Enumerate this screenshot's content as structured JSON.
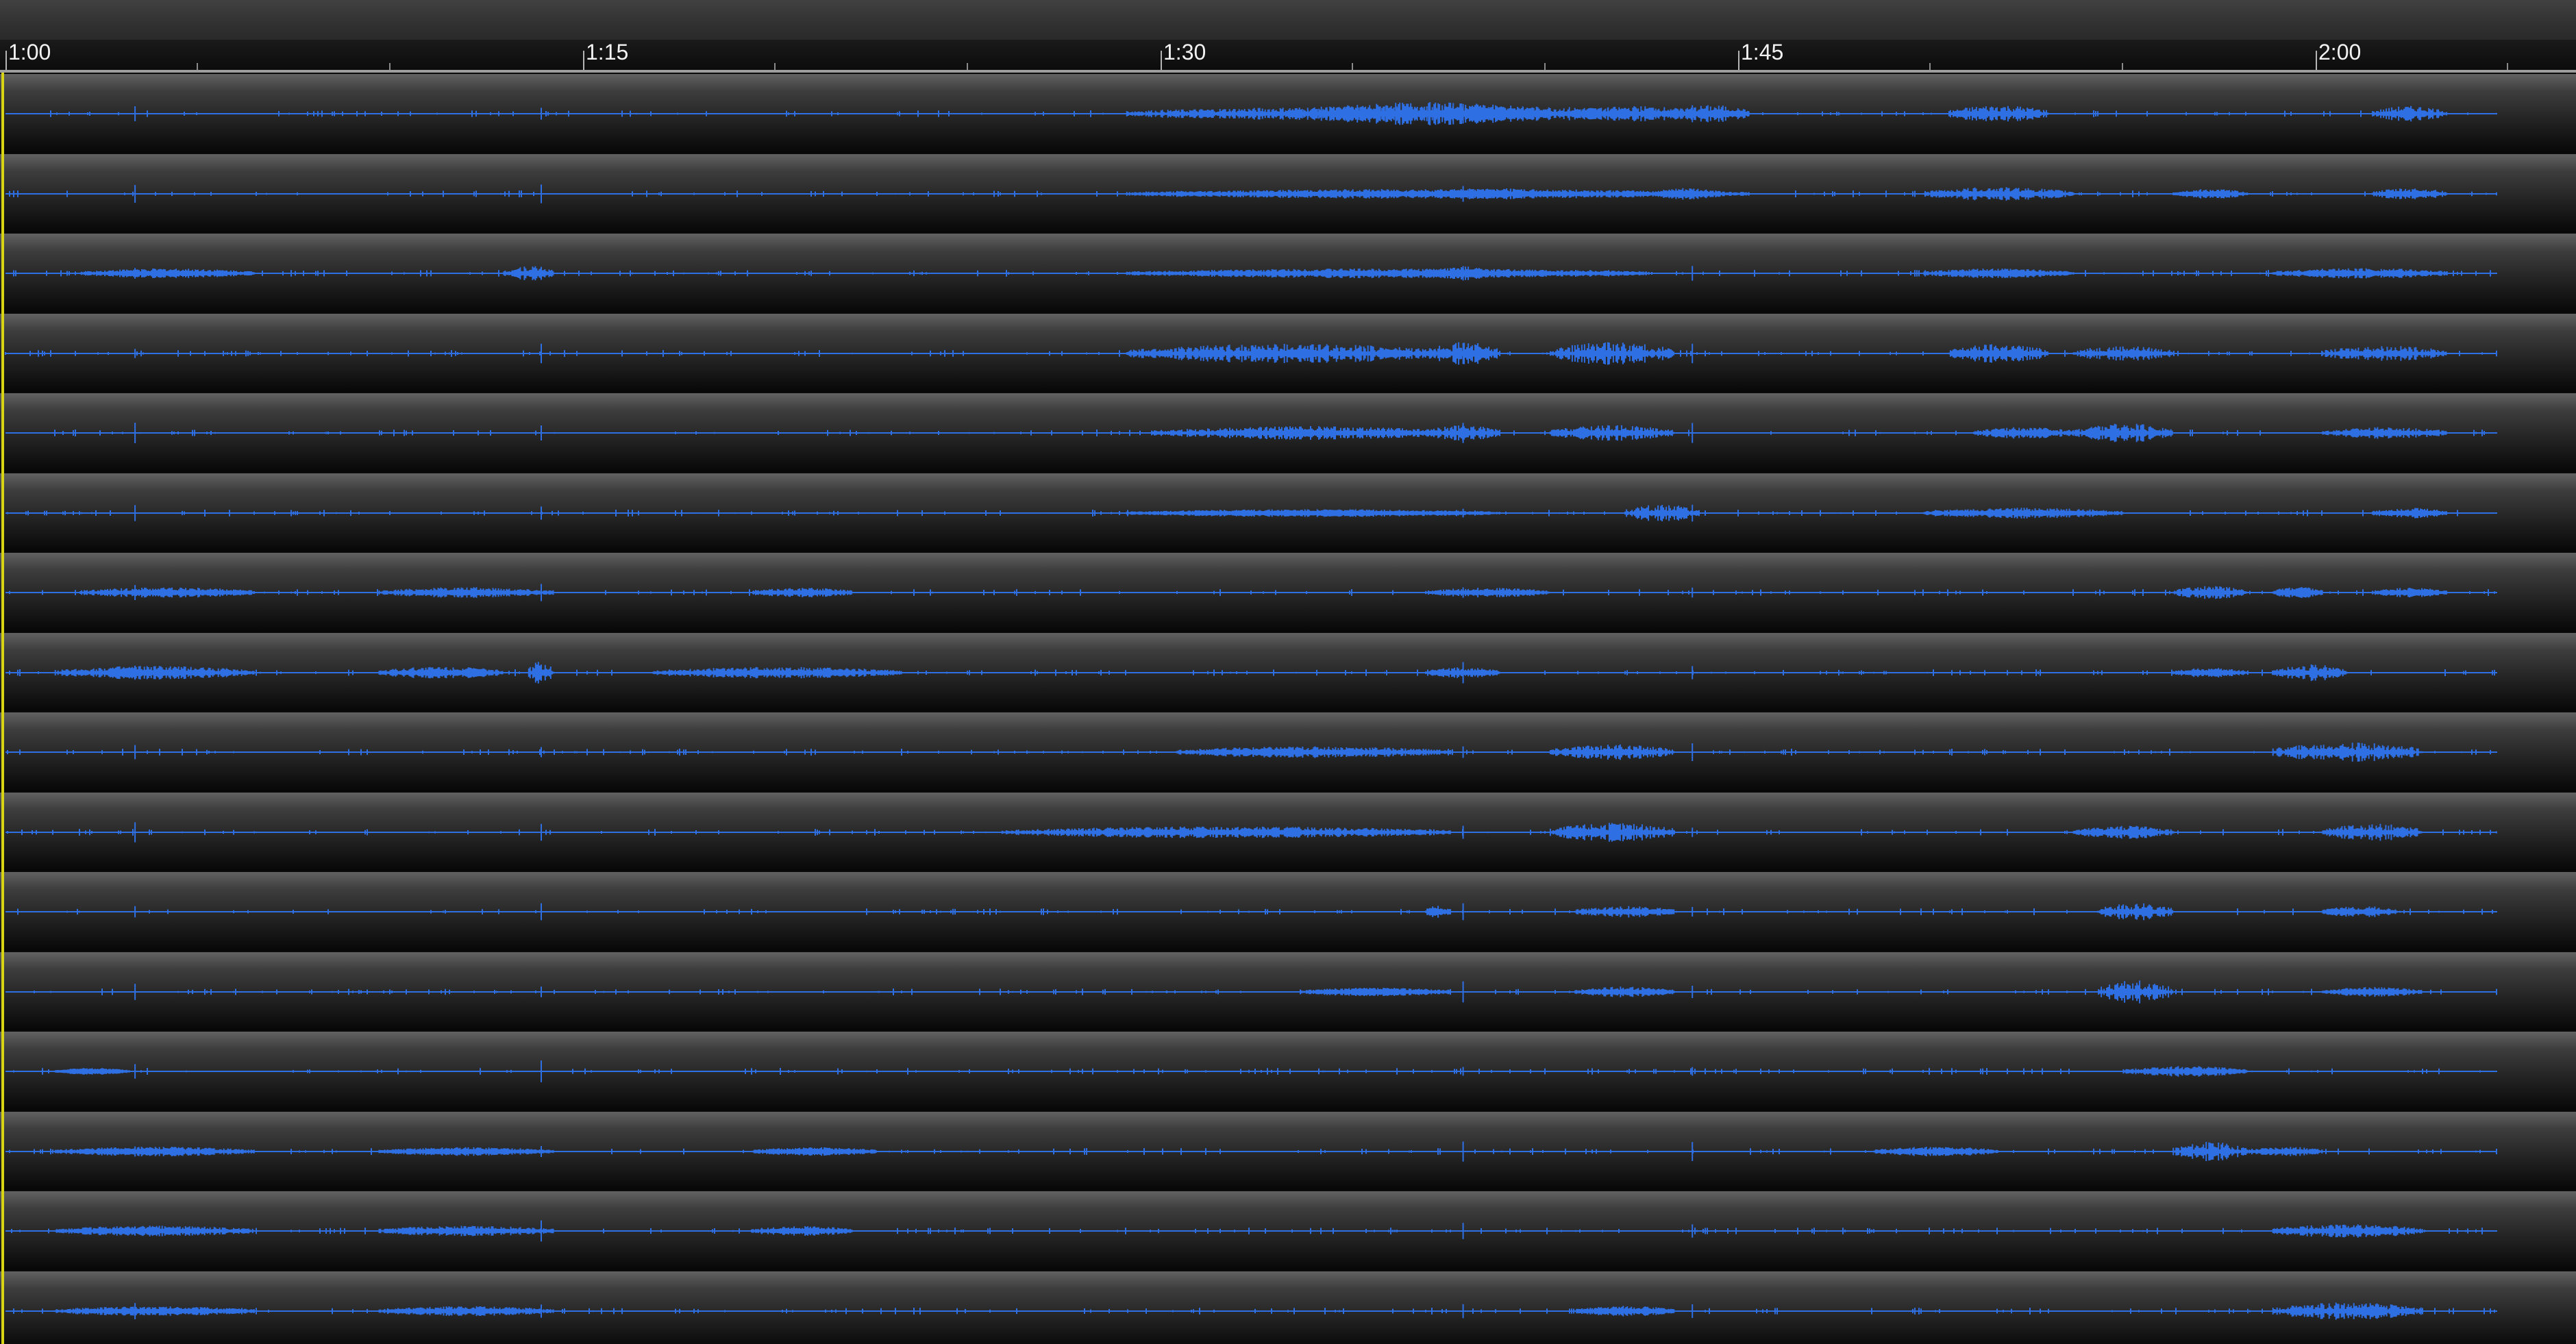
{
  "timeline": {
    "ruler_labels": [
      "1:00",
      "1:15",
      "1:30",
      "1:45",
      "2:00"
    ]
  },
  "colors": {
    "waveform": "#2f6fe4",
    "playhead": "#d8d313",
    "ruler_text": "#f2f2f2"
  },
  "tracks": [
    {
      "bursts": [
        [
          0.45,
          0.7,
          0.6
        ],
        [
          0.52,
          0.62,
          1.0
        ],
        [
          0.57,
          0.62,
          0.7
        ],
        [
          0.63,
          0.68,
          0.6
        ],
        [
          0.67,
          0.7,
          0.7
        ],
        [
          0.78,
          0.82,
          0.7
        ],
        [
          0.95,
          0.98,
          0.6
        ]
      ]
    },
    {
      "bursts": [
        [
          0.45,
          0.7,
          0.3
        ],
        [
          0.57,
          0.62,
          0.4
        ],
        [
          0.66,
          0.69,
          0.4
        ],
        [
          0.77,
          0.83,
          0.5
        ],
        [
          0.87,
          0.9,
          0.3
        ],
        [
          0.95,
          0.98,
          0.4
        ]
      ]
    },
    {
      "bursts": [
        [
          0.03,
          0.1,
          0.3
        ],
        [
          0.2,
          0.22,
          0.6
        ],
        [
          0.45,
          0.66,
          0.3
        ],
        [
          0.57,
          0.6,
          0.5
        ],
        [
          0.77,
          0.83,
          0.3
        ],
        [
          0.91,
          0.98,
          0.35
        ]
      ]
    },
    {
      "bursts": [
        [
          0.45,
          0.58,
          0.8
        ],
        [
          0.57,
          0.6,
          1.0
        ],
        [
          0.62,
          0.67,
          1.0
        ],
        [
          0.78,
          0.82,
          0.8
        ],
        [
          0.83,
          0.87,
          0.6
        ],
        [
          0.93,
          0.98,
          0.6
        ]
      ]
    },
    {
      "bursts": [
        [
          0.46,
          0.58,
          0.5
        ],
        [
          0.57,
          0.6,
          0.6
        ],
        [
          0.62,
          0.67,
          0.6
        ],
        [
          0.79,
          0.83,
          0.4
        ],
        [
          0.83,
          0.87,
          0.8
        ],
        [
          0.93,
          0.98,
          0.4
        ]
      ]
    },
    {
      "bursts": [
        [
          0.45,
          0.6,
          0.2
        ],
        [
          0.65,
          0.68,
          0.7
        ],
        [
          0.77,
          0.85,
          0.35
        ],
        [
          0.95,
          0.98,
          0.35
        ]
      ]
    },
    {
      "bursts": [
        [
          0.03,
          0.1,
          0.35
        ],
        [
          0.15,
          0.22,
          0.35
        ],
        [
          0.3,
          0.34,
          0.3
        ],
        [
          0.57,
          0.62,
          0.3
        ],
        [
          0.87,
          0.9,
          0.5
        ],
        [
          0.91,
          0.93,
          0.4
        ],
        [
          0.95,
          0.98,
          0.3
        ]
      ]
    },
    {
      "bursts": [
        [
          0.02,
          0.1,
          0.5
        ],
        [
          0.15,
          0.2,
          0.45
        ],
        [
          0.21,
          0.22,
          1.0
        ],
        [
          0.26,
          0.36,
          0.4
        ],
        [
          0.57,
          0.6,
          0.35
        ],
        [
          0.87,
          0.9,
          0.3
        ],
        [
          0.91,
          0.94,
          0.7
        ]
      ]
    },
    {
      "bursts": [
        [
          0.47,
          0.58,
          0.4
        ],
        [
          0.62,
          0.67,
          0.6
        ],
        [
          0.91,
          0.97,
          0.8
        ]
      ]
    },
    {
      "bursts": [
        [
          0.4,
          0.58,
          0.4
        ],
        [
          0.62,
          0.67,
          0.8
        ],
        [
          0.83,
          0.87,
          0.5
        ],
        [
          0.93,
          0.97,
          0.7
        ]
      ]
    },
    {
      "bursts": [
        [
          0.57,
          0.58,
          0.5
        ],
        [
          0.63,
          0.67,
          0.4
        ],
        [
          0.84,
          0.87,
          0.7
        ],
        [
          0.93,
          0.96,
          0.4
        ]
      ]
    },
    {
      "bursts": [
        [
          0.52,
          0.58,
          0.25
        ],
        [
          0.63,
          0.67,
          0.35
        ],
        [
          0.84,
          0.87,
          1.0
        ],
        [
          0.93,
          0.97,
          0.3
        ]
      ]
    },
    {
      "bursts": [
        [
          0.02,
          0.05,
          0.15
        ],
        [
          0.85,
          0.9,
          0.35
        ]
      ]
    },
    {
      "bursts": [
        [
          0.02,
          0.1,
          0.3
        ],
        [
          0.15,
          0.22,
          0.25
        ],
        [
          0.3,
          0.35,
          0.25
        ],
        [
          0.75,
          0.8,
          0.3
        ],
        [
          0.87,
          0.9,
          0.8
        ],
        [
          0.9,
          0.93,
          0.3
        ]
      ]
    },
    {
      "bursts": [
        [
          0.02,
          0.1,
          0.35
        ],
        [
          0.15,
          0.22,
          0.35
        ],
        [
          0.3,
          0.34,
          0.3
        ],
        [
          0.91,
          0.97,
          0.5
        ]
      ]
    },
    {
      "bursts": [
        [
          0.02,
          0.1,
          0.3
        ],
        [
          0.15,
          0.22,
          0.3
        ],
        [
          0.63,
          0.67,
          0.35
        ],
        [
          0.91,
          0.97,
          0.7
        ]
      ]
    }
  ]
}
